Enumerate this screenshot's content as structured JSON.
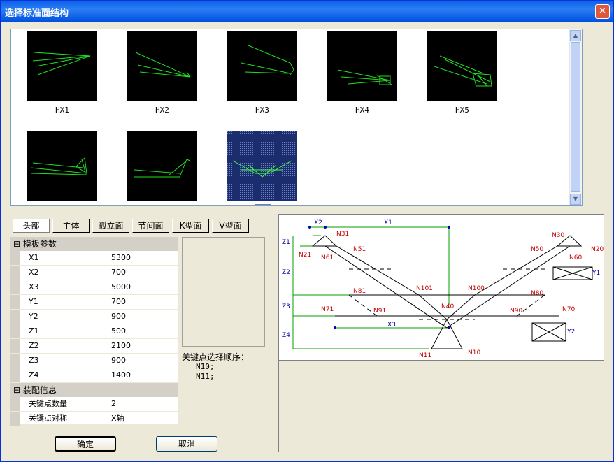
{
  "window": {
    "title": "选择标准面结构",
    "close_symbol": "✕"
  },
  "gallery": {
    "items": [
      {
        "label": "HX1"
      },
      {
        "label": "HX2"
      },
      {
        "label": "HX3"
      },
      {
        "label": "HX4"
      },
      {
        "label": "HX5"
      },
      {
        "label": ""
      },
      {
        "label": ""
      },
      {
        "label": "",
        "selected": true
      }
    ],
    "scroll_up": "▲",
    "scroll_down": "▼"
  },
  "tabs": [
    {
      "label": "头部",
      "active": true
    },
    {
      "label": "主体"
    },
    {
      "label": "孤立面"
    },
    {
      "label": "节间面"
    },
    {
      "label": "K型面"
    },
    {
      "label": "V型面"
    }
  ],
  "params": {
    "section1": "模板参数",
    "rows1": [
      {
        "key": "X1",
        "value": "5300"
      },
      {
        "key": "X2",
        "value": "700"
      },
      {
        "key": "X3",
        "value": "5000"
      },
      {
        "key": "Y1",
        "value": "700"
      },
      {
        "key": "Y2",
        "value": "900"
      },
      {
        "key": "Z1",
        "value": "500"
      },
      {
        "key": "Z2",
        "value": "2100"
      },
      {
        "key": "Z3",
        "value": "900"
      },
      {
        "key": "Z4",
        "value": "1400"
      }
    ],
    "section2": "装配信息",
    "rows2": [
      {
        "key": "关键点数量",
        "value": "2"
      },
      {
        "key": "关键点对称",
        "value": "X轴"
      }
    ],
    "collapse_symbol": "⊟"
  },
  "keypoints": {
    "title": "关键点选择顺序：",
    "items": [
      "N10;",
      "N11;"
    ]
  },
  "diagram": {
    "dims": [
      "X2",
      "X1",
      "Z1",
      "Z2",
      "Z3",
      "Z4",
      "X3",
      "Y1",
      "Y2"
    ],
    "nodes": [
      "N31",
      "N21",
      "N61",
      "N51",
      "N30",
      "N20",
      "N50",
      "N60",
      "N81",
      "N101",
      "N100",
      "N80",
      "N71",
      "N91",
      "N40",
      "N90",
      "N70",
      "N11",
      "N10"
    ]
  },
  "buttons": {
    "ok": "确定",
    "cancel": "取消"
  }
}
